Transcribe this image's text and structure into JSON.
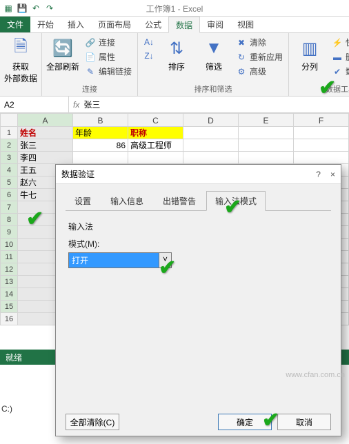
{
  "app": {
    "title": "工作簿1 - Excel"
  },
  "tabs": {
    "file": "文件",
    "home": "开始",
    "insert": "插入",
    "layout": "页面布局",
    "formula": "公式",
    "data": "数据",
    "review": "审阅",
    "view": "视图"
  },
  "ribbon": {
    "external": {
      "label": "获取\n外部数据",
      "group": ""
    },
    "conn": {
      "refresh": "全部刷新",
      "conn": "连接",
      "props": "属性",
      "edit": "编辑链接",
      "group": "连接"
    },
    "sort": {
      "az": "A→Z",
      "za": "Z→A",
      "sort": "排序",
      "filter": "筛选",
      "clear": "清除",
      "reapply": "重新应用",
      "adv": "高级",
      "group": "排序和筛选"
    },
    "tools": {
      "split": "分列",
      "flash": "快速填充",
      "dup": "删除重复项",
      "valid": "数据验证",
      "group": "数据工具"
    }
  },
  "namebox": "A2",
  "formula_val": "张三",
  "cols": [
    "A",
    "B",
    "C",
    "D",
    "E",
    "F"
  ],
  "rows": [
    "1",
    "2",
    "3",
    "4",
    "5",
    "6",
    "7",
    "8",
    "9",
    "10",
    "11",
    "12",
    "13",
    "14",
    "15",
    "16"
  ],
  "head": {
    "name": "姓名",
    "age": "年龄",
    "title": "职称"
  },
  "data_rows": [
    {
      "n": "张三",
      "a": "86",
      "t": "高级工程师"
    },
    {
      "n": "李四",
      "a": "",
      "t": ""
    },
    {
      "n": "王五",
      "a": "",
      "t": ""
    },
    {
      "n": "赵六",
      "a": "",
      "t": ""
    },
    {
      "n": "牛七",
      "a": "",
      "t": ""
    }
  ],
  "status": "就绪",
  "dialog": {
    "title": "数据验证",
    "tabs": {
      "settings": "设置",
      "input": "输入信息",
      "error": "出错警告",
      "ime": "输入法模式"
    },
    "section": "输入法",
    "mode_label": "模式(M):",
    "mode_value": "打开",
    "clear": "全部清除(C)",
    "ok": "确定",
    "cancel": "取消",
    "help": "?",
    "close": "×"
  },
  "watermark": "www.cfan.com.cn",
  "drive": "C:)"
}
